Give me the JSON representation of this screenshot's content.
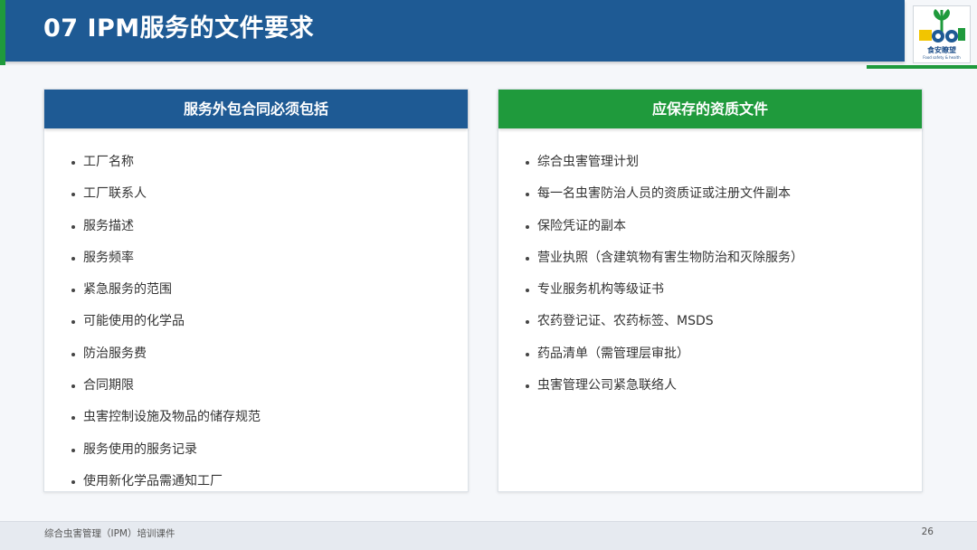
{
  "header": {
    "title": "07  IPM服务的文件要求",
    "logo_text": "食安瞭望",
    "logo_subtext": "Food safety & health"
  },
  "left_panel": {
    "title": "服务外包合同必须包括",
    "items": [
      "工厂名称",
      "工厂联系人",
      "服务描述",
      "服务频率",
      "紧急服务的范围",
      "可能使用的化学品",
      "防治服务费",
      "合同期限",
      "虫害控制设施及物品的储存规范",
      "服务使用的服务记录",
      "使用新化学品需通知工厂"
    ]
  },
  "right_panel": {
    "title": "应保存的资质文件",
    "items": [
      "综合虫害管理计划",
      "每一名虫害防治人员的资质证或注册文件副本",
      "保险凭证的副本",
      "营业执照（含建筑物有害生物防治和灭除服务）",
      "专业服务机构等级证书",
      "农药登记证、农药标签、MSDS",
      "药品清单（需管理层审批）",
      "虫害管理公司紧急联络人"
    ]
  },
  "footer": {
    "text": "综合虫害管理（IPM）培训课件",
    "page": "26"
  },
  "colors": {
    "primary_blue": "#1e5a94",
    "accent_green": "#1f9a3c"
  },
  "icons": [
    "logo-icon"
  ]
}
